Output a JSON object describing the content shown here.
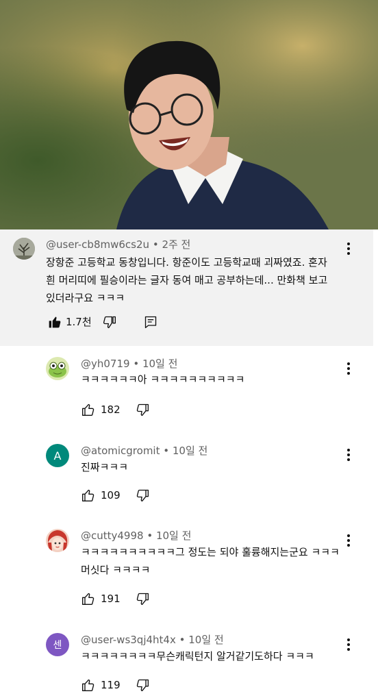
{
  "main_comment": {
    "username": "@user-cb8mw6cs2u",
    "time": "2주 전",
    "text_line1": "장항준 고등학교 동창입니다. 항준이도 고등학교때 괴짜였죠. 혼자",
    "text_line2": "흰 머리띠에 필승이라는 글자 동여 매고 공부하는데... 만화책 보고",
    "text_line3": "있더라구요 ㅋㅋㅋ",
    "likes": "1.7천"
  },
  "replies": [
    {
      "username": "@yh0719",
      "time": "10일 전",
      "text_line1": "ㅋㅋㅋㅋㅋㅋ아 ㅋㅋㅋㅋㅋㅋㅋㅋㅋㅋ",
      "text_line2": "",
      "likes": "182",
      "avatar_letter": "",
      "avatar_color": "#dce9b0"
    },
    {
      "username": "@atomicgromit",
      "time": "10일 전",
      "text_line1": "진짜ㅋㅋㅋ",
      "text_line2": "",
      "likes": "109",
      "avatar_letter": "A",
      "avatar_color": "#00897b"
    },
    {
      "username": "@cutty4998",
      "time": "10일 전",
      "text_line1": "ㅋㅋㅋㅋㅋㅋㅋㅋㅋㅋ그 정도는 되야 훌륭해지는군요 ㅋㅋㅋ",
      "text_line2": "머싯다 ㅋㅋㅋㅋ",
      "likes": "191",
      "avatar_letter": "",
      "avatar_color": "#f7d7c9"
    },
    {
      "username": "@user-ws3qj4ht4x",
      "time": "10일 전",
      "text_line1": "ㅋㅋㅋㅋㅋㅋㅋㅋ무슨캐릭턴지 알거같기도하다 ㅋㅋㅋ",
      "text_line2": "",
      "likes": "119",
      "avatar_letter": "센",
      "avatar_color": "#7e57c2"
    }
  ],
  "colors": {
    "main_bg": "#f2f2f2",
    "meta_text": "#606060",
    "text": "#0f0f0f"
  },
  "icons": [
    "like-filled-icon",
    "like-icon",
    "dislike-icon",
    "reply-icon",
    "more-vert-icon"
  ]
}
